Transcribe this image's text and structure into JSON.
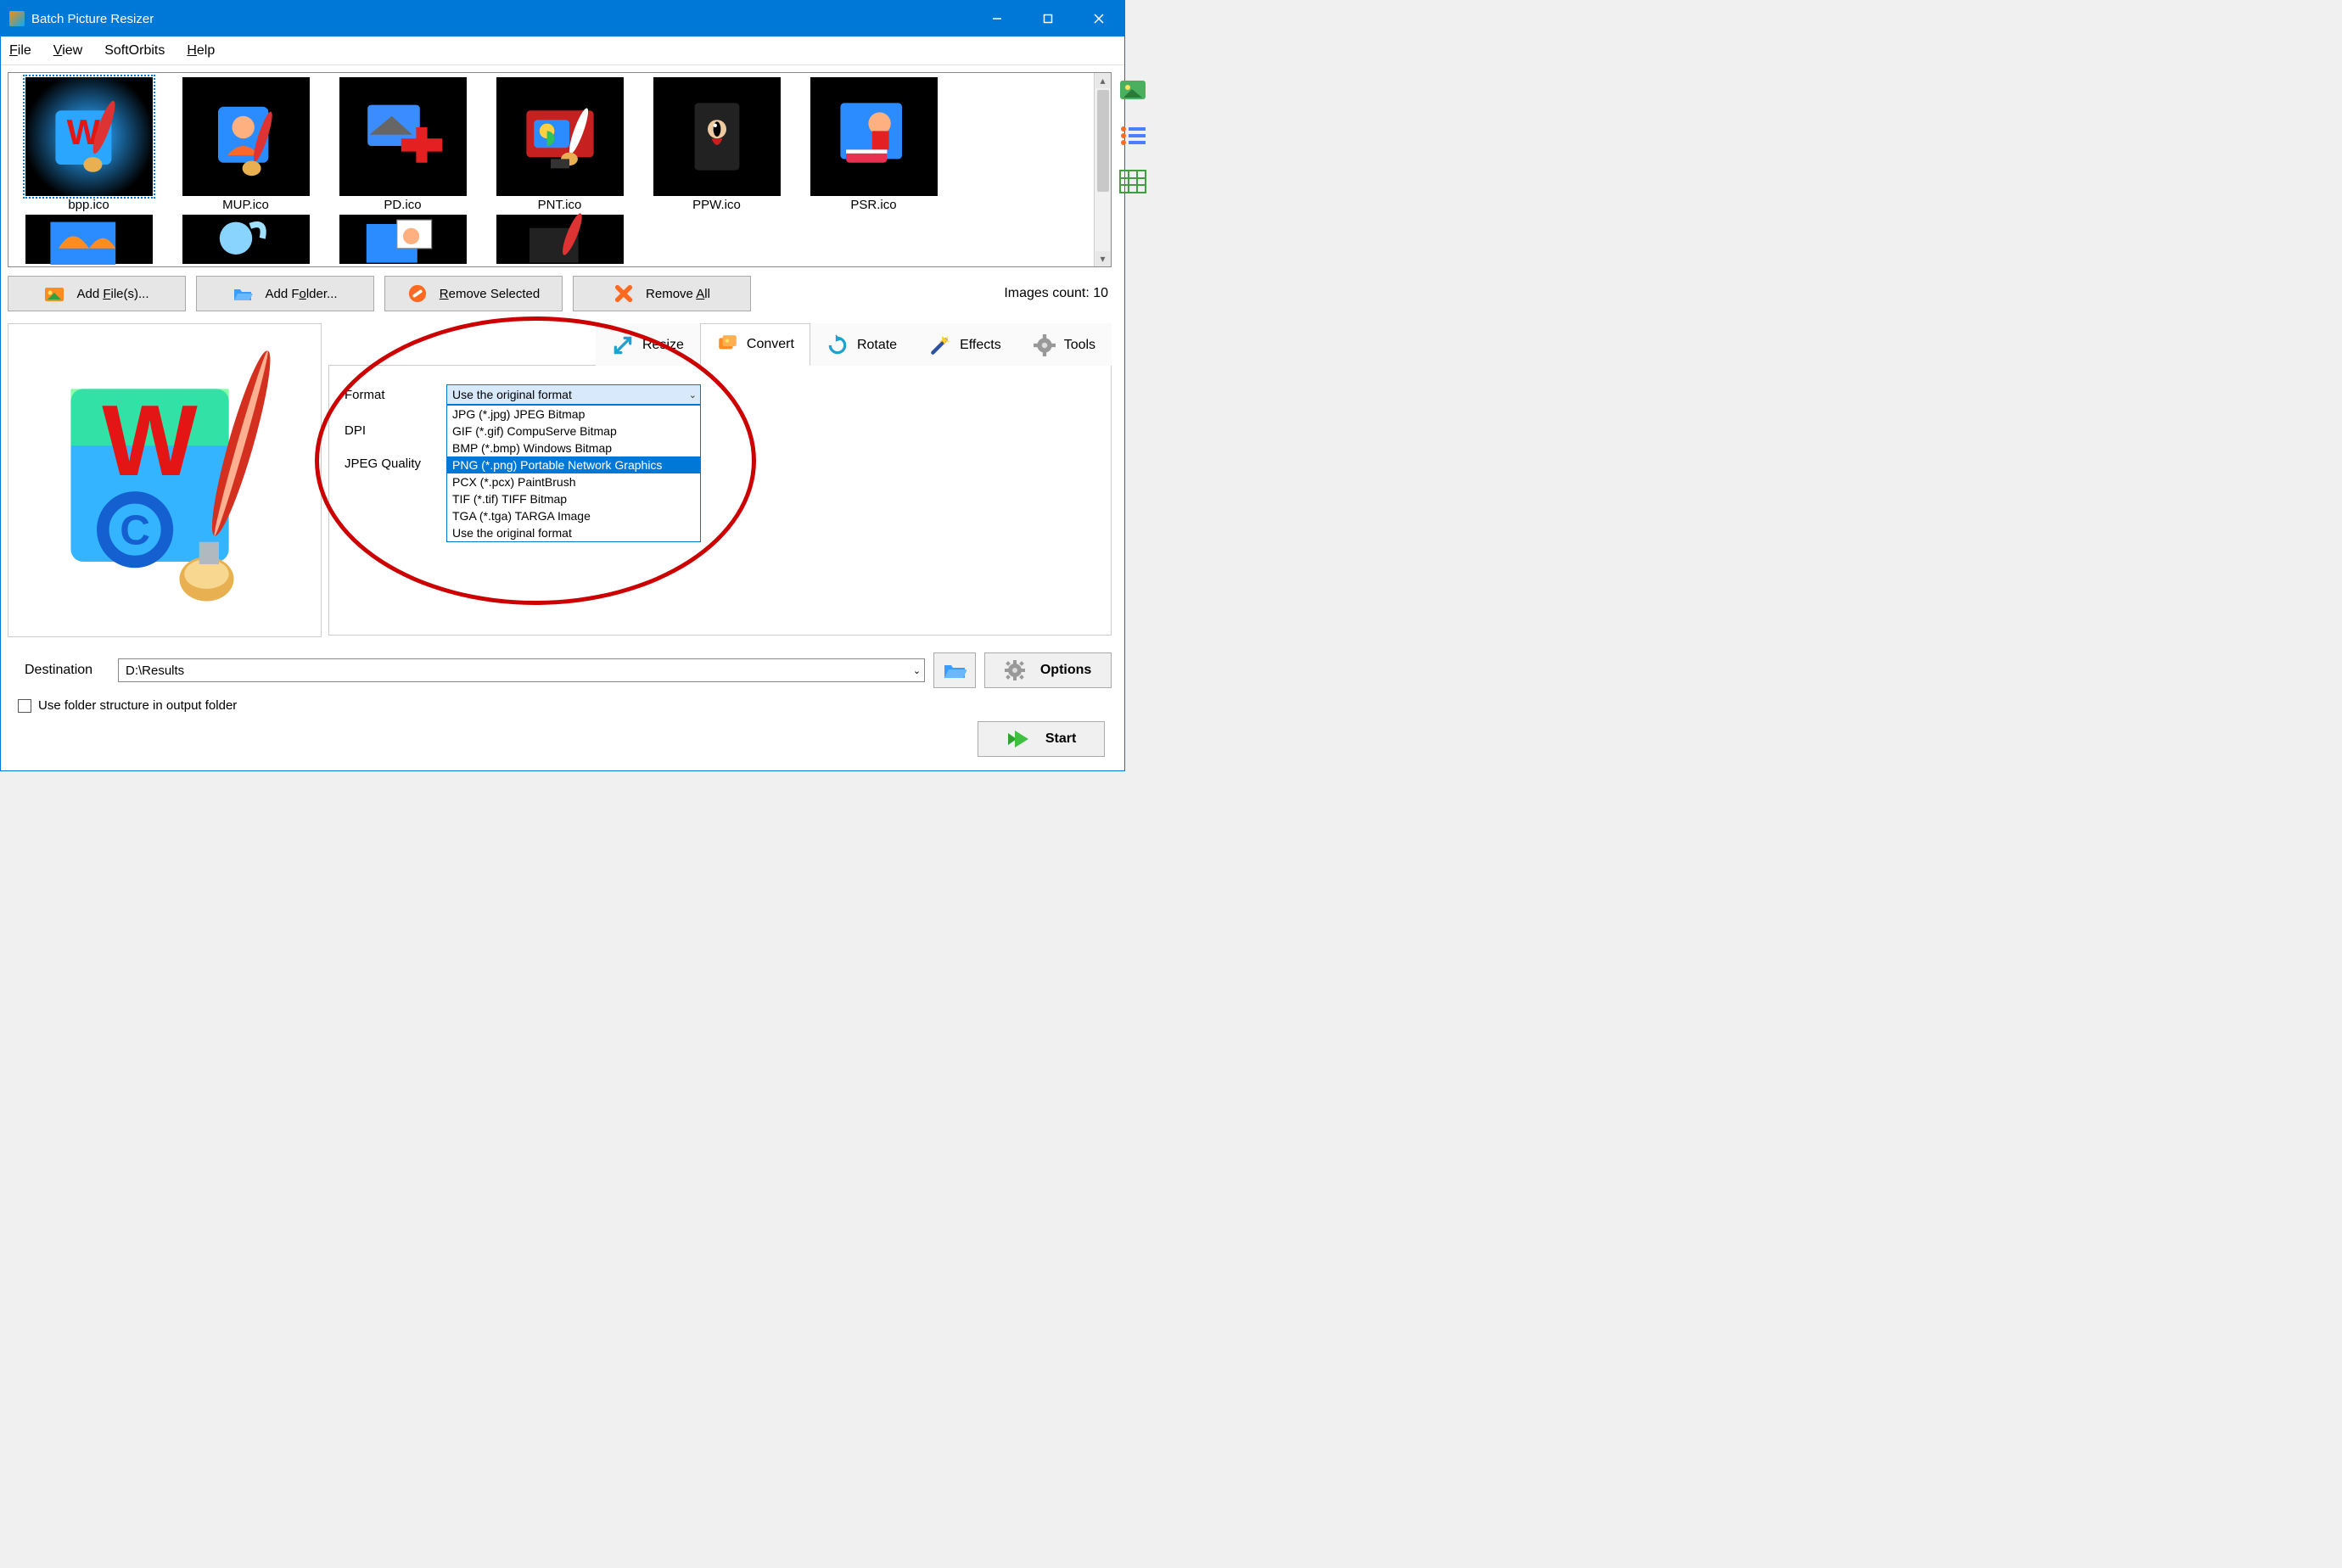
{
  "titlebar": {
    "title": "Batch Picture Resizer"
  },
  "menu": {
    "file": "File",
    "view": "View",
    "softorbits": "SoftOrbits",
    "help": "Help"
  },
  "thumbs": [
    {
      "label": "bpp.ico"
    },
    {
      "label": "MUP.ico"
    },
    {
      "label": "PD.ico"
    },
    {
      "label": "PNT.ico"
    },
    {
      "label": "PPW.ico"
    },
    {
      "label": "PSR.ico"
    }
  ],
  "toolbar": {
    "add_files": "Add File(s)...",
    "add_folder": "Add Folder...",
    "remove_selected": "Remove Selected",
    "remove_all": "Remove All"
  },
  "count_label": "Images count: 10",
  "tabs": {
    "resize": "Resize",
    "convert": "Convert",
    "rotate": "Rotate",
    "effects": "Effects",
    "tools": "Tools"
  },
  "convert": {
    "format_label": "Format",
    "dpi_label": "DPI",
    "jpeg_label": "JPEG Quality",
    "selected": "Use the original format",
    "options": [
      "JPG (*.jpg) JPEG Bitmap",
      "GIF (*.gif) CompuServe Bitmap",
      "BMP (*.bmp) Windows Bitmap",
      "PNG (*.png) Portable Network Graphics",
      "PCX (*.pcx) PaintBrush",
      "TIF (*.tif) TIFF Bitmap",
      "TGA (*.tga) TARGA Image",
      "Use the original format"
    ],
    "highlighted_index": 3
  },
  "destination": {
    "label": "Destination",
    "value": "D:\\Results"
  },
  "use_folder_structure": "Use folder structure in output folder",
  "buttons": {
    "options": "Options",
    "start": "Start"
  }
}
